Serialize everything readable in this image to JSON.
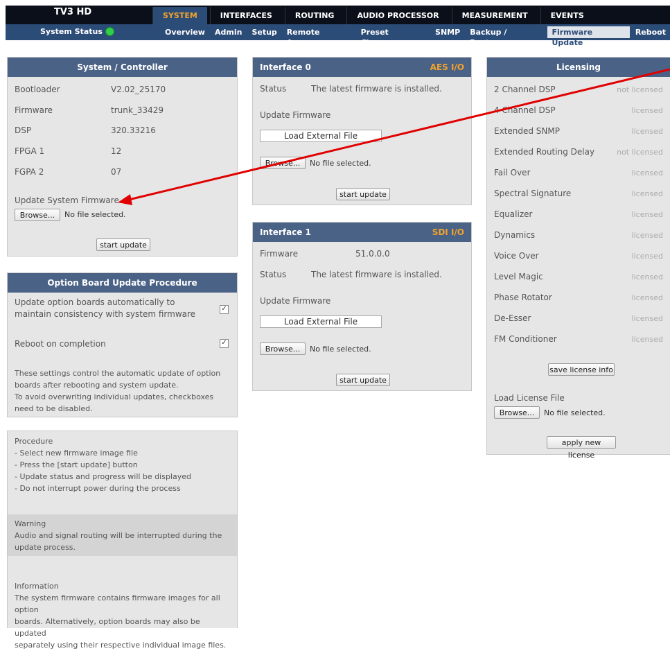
{
  "header": {
    "brand": "TV3 HD",
    "status_label": "System Status",
    "main_tabs": [
      "SYSTEM",
      "INTERFACES",
      "ROUTING",
      "AUDIO PROCESSOR",
      "MEASUREMENT",
      "EVENTS"
    ],
    "sub_tabs": [
      "Overview",
      "Admin",
      "Setup",
      "Remote Access",
      "Preset Cleanup",
      "SNMP",
      "Backup / Restore",
      "Firmware Update",
      "Reboot"
    ]
  },
  "system": {
    "title": "System / Controller",
    "rows": [
      {
        "label": "Bootloader",
        "value": "V2.02_25170"
      },
      {
        "label": "Firmware",
        "value": "trunk_33429"
      },
      {
        "label": "DSP",
        "value": "320.33216"
      },
      {
        "label": "FPGA 1",
        "value": "12"
      },
      {
        "label": "FGPA 2",
        "value": "07"
      }
    ],
    "update_label": "Update System Firmware",
    "browse": "Browse...",
    "no_file": "No file selected.",
    "start": "start update"
  },
  "option_board": {
    "title": "Option Board Update Procedure",
    "auto_label_1": "Update option boards automatically to",
    "auto_label_2": "maintain consistency with system firmware",
    "reboot_label": "Reboot on completion",
    "check": "✓",
    "note_lines": [
      "These settings control the automatic update of option",
      "boards after rebooting and system update.",
      "To avoid overwriting individual updates, checkboxes",
      "need to be disabled."
    ]
  },
  "procedure": {
    "lines": [
      "Procedure",
      "- Select new firmware image file",
      "- Press the [start update] button",
      "- Update status and progress will be displayed",
      "- Do not interrupt power during the process"
    ]
  },
  "warning": {
    "lines": [
      "Warning",
      "Audio and signal routing will be interrupted during the",
      "update process."
    ]
  },
  "information": {
    "lines": [
      "Information",
      "The system firmware contains firmware images for all option",
      "boards. Alternatively, option boards may also be updated",
      "separately using their respective individual image files."
    ]
  },
  "interface0": {
    "title": "Interface 0",
    "type": "AES I/O",
    "status_label": "Status",
    "status_value": "The latest firmware is installed.",
    "update_label": "Update Firmware",
    "load_external": "Load External File",
    "browse": "Browse...",
    "no_file": "No file selected.",
    "start": "start update"
  },
  "interface1": {
    "title": "Interface 1",
    "type": "SDI I/O",
    "firmware_label": "Firmware",
    "firmware_value": "51.0.0.0",
    "status_label": "Status",
    "status_value": "The latest firmware is installed.",
    "update_label": "Update Firmware",
    "load_external": "Load External File",
    "browse": "Browse...",
    "no_file": "No file selected.",
    "start": "start update"
  },
  "licensing": {
    "title": "Licensing",
    "items": [
      {
        "name": "2 Channel DSP",
        "status": "not licensed"
      },
      {
        "name": "4 Channel DSP",
        "status": "licensed"
      },
      {
        "name": "Extended SNMP",
        "status": "licensed"
      },
      {
        "name": "Extended Routing Delay",
        "status": "not licensed"
      },
      {
        "name": "Fail Over",
        "status": "licensed"
      },
      {
        "name": "Spectral Signature",
        "status": "licensed"
      },
      {
        "name": "Equalizer",
        "status": "licensed"
      },
      {
        "name": "Dynamics",
        "status": "licensed"
      },
      {
        "name": "Voice Over",
        "status": "licensed"
      },
      {
        "name": "Level Magic",
        "status": "licensed"
      },
      {
        "name": "Phase Rotator",
        "status": "licensed"
      },
      {
        "name": "De-Esser",
        "status": "licensed"
      },
      {
        "name": "FM Conditioner",
        "status": "licensed"
      }
    ],
    "save": "save license info",
    "load_label": "Load License File",
    "browse": "Browse...",
    "no_file": "No file selected.",
    "apply": "apply new license"
  },
  "colors": {
    "header_dark": "#0b0f1a",
    "nav_blue": "#2c4c78",
    "panel_head": "#4a6286",
    "accent_orange": "#f3a32a",
    "status_green": "#2fcf4b",
    "annotation_red": "#e00000"
  }
}
